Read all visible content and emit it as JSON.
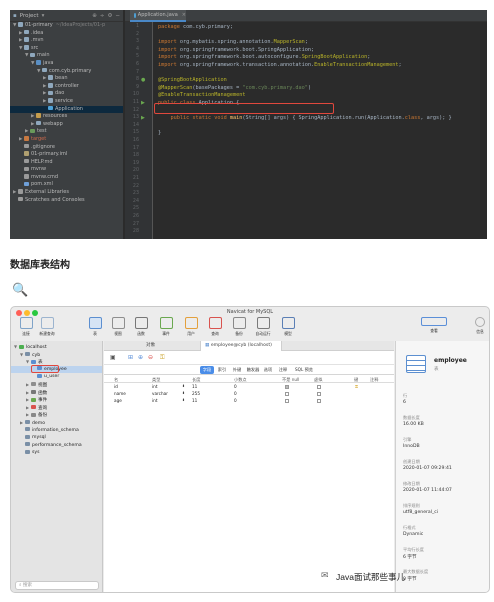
{
  "ide": {
    "header": {
      "label": "Project",
      "icons": [
        "target-icon",
        "split-icon",
        "gear-icon",
        "minus-icon"
      ]
    },
    "tree": [
      {
        "indent": 0,
        "arrow": "▼",
        "color": "#8fa8bd",
        "text": "01-primary",
        "dim": "~/IdeaProjects/01-p"
      },
      {
        "indent": 1,
        "arrow": "▶",
        "color": "#8fa8bd",
        "text": ".idea"
      },
      {
        "indent": 1,
        "arrow": "▶",
        "color": "#8fa8bd",
        "text": ".mvn"
      },
      {
        "indent": 1,
        "arrow": "▼",
        "color": "#8fa8bd",
        "text": "src"
      },
      {
        "indent": 2,
        "arrow": "▼",
        "color": "#8fa8bd",
        "text": "main"
      },
      {
        "indent": 3,
        "arrow": "▼",
        "color": "#5a8fc4",
        "text": "java"
      },
      {
        "indent": 4,
        "arrow": "▼",
        "color": "#8fa8bd",
        "text": "com.cyb.primary"
      },
      {
        "indent": 5,
        "arrow": "▶",
        "color": "#8fa8bd",
        "text": "bean"
      },
      {
        "indent": 5,
        "arrow": "▶",
        "color": "#8fa8bd",
        "text": "controller"
      },
      {
        "indent": 5,
        "arrow": "▶",
        "color": "#8fa8bd",
        "text": "dao"
      },
      {
        "indent": 5,
        "arrow": "▶",
        "color": "#8fa8bd",
        "text": "service"
      },
      {
        "indent": 5,
        "arrow": "",
        "color": "#4fa3d9",
        "text": "Application",
        "sel": true
      },
      {
        "indent": 3,
        "arrow": "▶",
        "color": "#c59d4d",
        "text": "resources"
      },
      {
        "indent": 3,
        "arrow": "▶",
        "color": "#8fa8bd",
        "text": "webapp"
      },
      {
        "indent": 2,
        "arrow": "▶",
        "color": "#6a9a5b",
        "text": "test"
      },
      {
        "indent": 1,
        "arrow": "▶",
        "color": "#c87941",
        "text": "target",
        "red": true
      },
      {
        "indent": 1,
        "arrow": "",
        "color": "#9a9a9a",
        "text": ".gitignore"
      },
      {
        "indent": 1,
        "arrow": "",
        "color": "#b0a070",
        "text": "01-primary.iml"
      },
      {
        "indent": 1,
        "arrow": "",
        "color": "#9a9a9a",
        "text": "HELP.md"
      },
      {
        "indent": 1,
        "arrow": "",
        "color": "#9a9a9a",
        "text": "mvnw"
      },
      {
        "indent": 1,
        "arrow": "",
        "color": "#9a9a9a",
        "text": "mvnw.cmd"
      },
      {
        "indent": 1,
        "arrow": "",
        "color": "#6fa0d8",
        "text": "pom.xml"
      },
      {
        "indent": 0,
        "arrow": "▶",
        "color": "#9a9a9a",
        "text": "External Libraries"
      },
      {
        "indent": 0,
        "arrow": "",
        "color": "#9a9a9a",
        "text": "Scratches and Consoles"
      }
    ],
    "tab": {
      "label": "Application.java"
    },
    "lines": [
      {
        "n": "1",
        "segs": [
          [
            "kw",
            "package "
          ],
          [
            "",
            "com.cyb.primary;"
          ]
        ]
      },
      {
        "n": "2",
        "segs": []
      },
      {
        "n": "3",
        "segs": [
          [
            "kw",
            "import "
          ],
          [
            "",
            "org.mybatis.spring.annotation."
          ],
          [
            "an",
            "MapperScan"
          ],
          [
            "",
            ";"
          ]
        ]
      },
      {
        "n": "4",
        "segs": [
          [
            "kw",
            "import "
          ],
          [
            "",
            "org.springframework.boot.SpringApplication;"
          ]
        ]
      },
      {
        "n": "5",
        "segs": [
          [
            "kw",
            "import "
          ],
          [
            "",
            "org.springframework.boot.autoconfigure."
          ],
          [
            "an",
            "SpringBootApplication"
          ],
          [
            "",
            ";"
          ]
        ]
      },
      {
        "n": "6",
        "segs": [
          [
            "kw",
            "import "
          ],
          [
            "",
            "org.springframework.transaction.annotation."
          ],
          [
            "an",
            "EnableTransactionManagement"
          ],
          [
            "",
            ";"
          ]
        ]
      },
      {
        "n": "7",
        "segs": []
      },
      {
        "n": "8",
        "segs": [
          [
            "an",
            "@SpringBootApplication"
          ]
        ]
      },
      {
        "n": "9",
        "segs": [
          [
            "an",
            "@MapperScan"
          ],
          [
            "",
            "(basePackages = "
          ],
          [
            "st",
            "\"com.cyb.primary.dao\""
          ],
          [
            "",
            ")"
          ]
        ]
      },
      {
        "n": "10",
        "segs": [
          [
            "an",
            "@EnableTransactionManagement"
          ]
        ]
      },
      {
        "n": "11",
        "segs": [
          [
            "kw",
            "public class "
          ],
          [
            "",
            "Application {"
          ]
        ]
      },
      {
        "n": "12",
        "segs": []
      },
      {
        "n": "13",
        "segs": [
          [
            "kw",
            "    public static void "
          ],
          [
            "fn",
            "main"
          ],
          [
            "",
            "(String[] args) { SpringApplication."
          ],
          [
            "",
            "run(Application."
          ],
          [
            "kw",
            "class"
          ],
          [
            "",
            ", args); }"
          ]
        ]
      },
      {
        "n": "14",
        "segs": []
      },
      {
        "n": "15",
        "segs": [
          [
            "",
            "}"
          ]
        ]
      },
      {
        "n": "16",
        "segs": []
      },
      {
        "n": "17",
        "segs": []
      },
      {
        "n": "18",
        "segs": []
      },
      {
        "n": "19",
        "segs": []
      },
      {
        "n": "20",
        "segs": []
      },
      {
        "n": "21",
        "segs": []
      },
      {
        "n": "22",
        "segs": []
      },
      {
        "n": "23",
        "segs": []
      },
      {
        "n": "24",
        "segs": []
      },
      {
        "n": "25",
        "segs": []
      },
      {
        "n": "26",
        "segs": []
      },
      {
        "n": "27",
        "segs": []
      },
      {
        "n": "28",
        "segs": []
      }
    ]
  },
  "section_title": "数据库表结构",
  "magnifier": "🔍",
  "navicat": {
    "title": "Navicat for MySQL",
    "toolbar": [
      {
        "label": "连接",
        "icon": "connection-icon",
        "color": "#7fa3c8"
      },
      {
        "label": "新建查询",
        "icon": "new-query-icon",
        "color": "#9cb4cf"
      },
      {
        "label": "表",
        "icon": "table-icon",
        "color": "#5c8fd0",
        "active": true
      },
      {
        "label": "视图",
        "icon": "view-icon",
        "color": "#8e8e8e"
      },
      {
        "label": "函数",
        "icon": "function-icon",
        "color": "#777"
      },
      {
        "label": "事件",
        "icon": "event-icon",
        "color": "#6aa84f"
      },
      {
        "label": "用户",
        "icon": "user-icon",
        "color": "#e3a03c"
      },
      {
        "label": "查询",
        "icon": "query-icon",
        "color": "#d9534f"
      },
      {
        "label": "备份",
        "icon": "backup-icon",
        "color": "#888"
      },
      {
        "label": "自动运行",
        "icon": "automation-icon",
        "color": "#7a7a7a"
      },
      {
        "label": "模型",
        "icon": "model-icon",
        "color": "#5b7fb5"
      },
      {
        "label": "查看",
        "icon": "view-toggle-icon",
        "color": "#5b8fd8"
      },
      {
        "label": "信息",
        "icon": "info-avatar-icon",
        "color": "#aaa"
      }
    ],
    "sidebar": [
      {
        "indent": 0,
        "arrow": "▼",
        "text": "localhost",
        "color": "#4caf50"
      },
      {
        "indent": 1,
        "arrow": "▼",
        "text": "cyb",
        "color": "#7a8fa6"
      },
      {
        "indent": 2,
        "arrow": "▼",
        "text": "表",
        "color": "#5c8fd0"
      },
      {
        "indent": 3,
        "arrow": "",
        "text": "employee",
        "color": "#5c8fd0",
        "sel": true,
        "boxed": true
      },
      {
        "indent": 3,
        "arrow": "",
        "text": "u_user",
        "color": "#5c8fd0"
      },
      {
        "indent": 2,
        "arrow": "▶",
        "text": "视图",
        "color": "#8e8e8e"
      },
      {
        "indent": 2,
        "arrow": "▶",
        "text": "函数",
        "color": "#777"
      },
      {
        "indent": 2,
        "arrow": "▶",
        "text": "事件",
        "color": "#6aa84f"
      },
      {
        "indent": 2,
        "arrow": "▶",
        "text": "查询",
        "color": "#d9534f"
      },
      {
        "indent": 2,
        "arrow": "▶",
        "text": "备份",
        "color": "#888"
      },
      {
        "indent": 1,
        "arrow": "▶",
        "text": "demo",
        "color": "#7a8fa6"
      },
      {
        "indent": 1,
        "arrow": "",
        "text": "information_schema",
        "color": "#7a8fa6"
      },
      {
        "indent": 1,
        "arrow": "",
        "text": "mysql",
        "color": "#7a8fa6"
      },
      {
        "indent": 1,
        "arrow": "",
        "text": "performance_schema",
        "color": "#7a8fa6"
      },
      {
        "indent": 1,
        "arrow": "",
        "text": "sys",
        "color": "#7a8fa6"
      }
    ],
    "search_placeholder": "搜索",
    "main_tabs": [
      {
        "label": "对象"
      },
      {
        "label": "employee@cyb (localhost)",
        "active": true
      }
    ],
    "subtabs": [
      {
        "label": "字段",
        "active": true
      },
      {
        "label": "索引"
      },
      {
        "label": "外键"
      },
      {
        "label": "触发器"
      },
      {
        "label": "选项"
      },
      {
        "label": "注释"
      },
      {
        "label": "SQL 预览"
      }
    ],
    "columns": [
      "名",
      "类型",
      "长度",
      "小数点",
      "不是 null",
      "虚拟",
      "键",
      "注释"
    ],
    "fields": [
      {
        "name": "id",
        "type": "int",
        "length": "11",
        "decimal": "0",
        "notnull": true,
        "virtual": false,
        "key": true
      },
      {
        "name": "name",
        "type": "varchar",
        "length": "255",
        "decimal": "0",
        "notnull": false,
        "virtual": false,
        "key": false
      },
      {
        "name": "age",
        "type": "int",
        "length": "11",
        "decimal": "0",
        "notnull": false,
        "virtual": false,
        "key": false
      }
    ],
    "info": {
      "table_name": "employee",
      "table_sub": "表",
      "items": [
        {
          "k": "行",
          "v": "6"
        },
        {
          "k": "数据长度",
          "v": "16.00 KB"
        },
        {
          "k": "引擎",
          "v": "InnoDB"
        },
        {
          "k": "创建日期",
          "v": "2020-01-07 09:29:41"
        },
        {
          "k": "修改日期",
          "v": "2020-01-07 11:44:07"
        },
        {
          "k": "排序规则",
          "v": "utf8_general_ci"
        },
        {
          "k": "行格式",
          "v": "Dynamic"
        },
        {
          "k": "平均行长度",
          "v": "6 字节"
        },
        {
          "k": "最大数据长度",
          "v": "0 字节"
        }
      ]
    }
  },
  "watermark": "Java面试那些事儿",
  "watermark_icon": "wechat-icon"
}
